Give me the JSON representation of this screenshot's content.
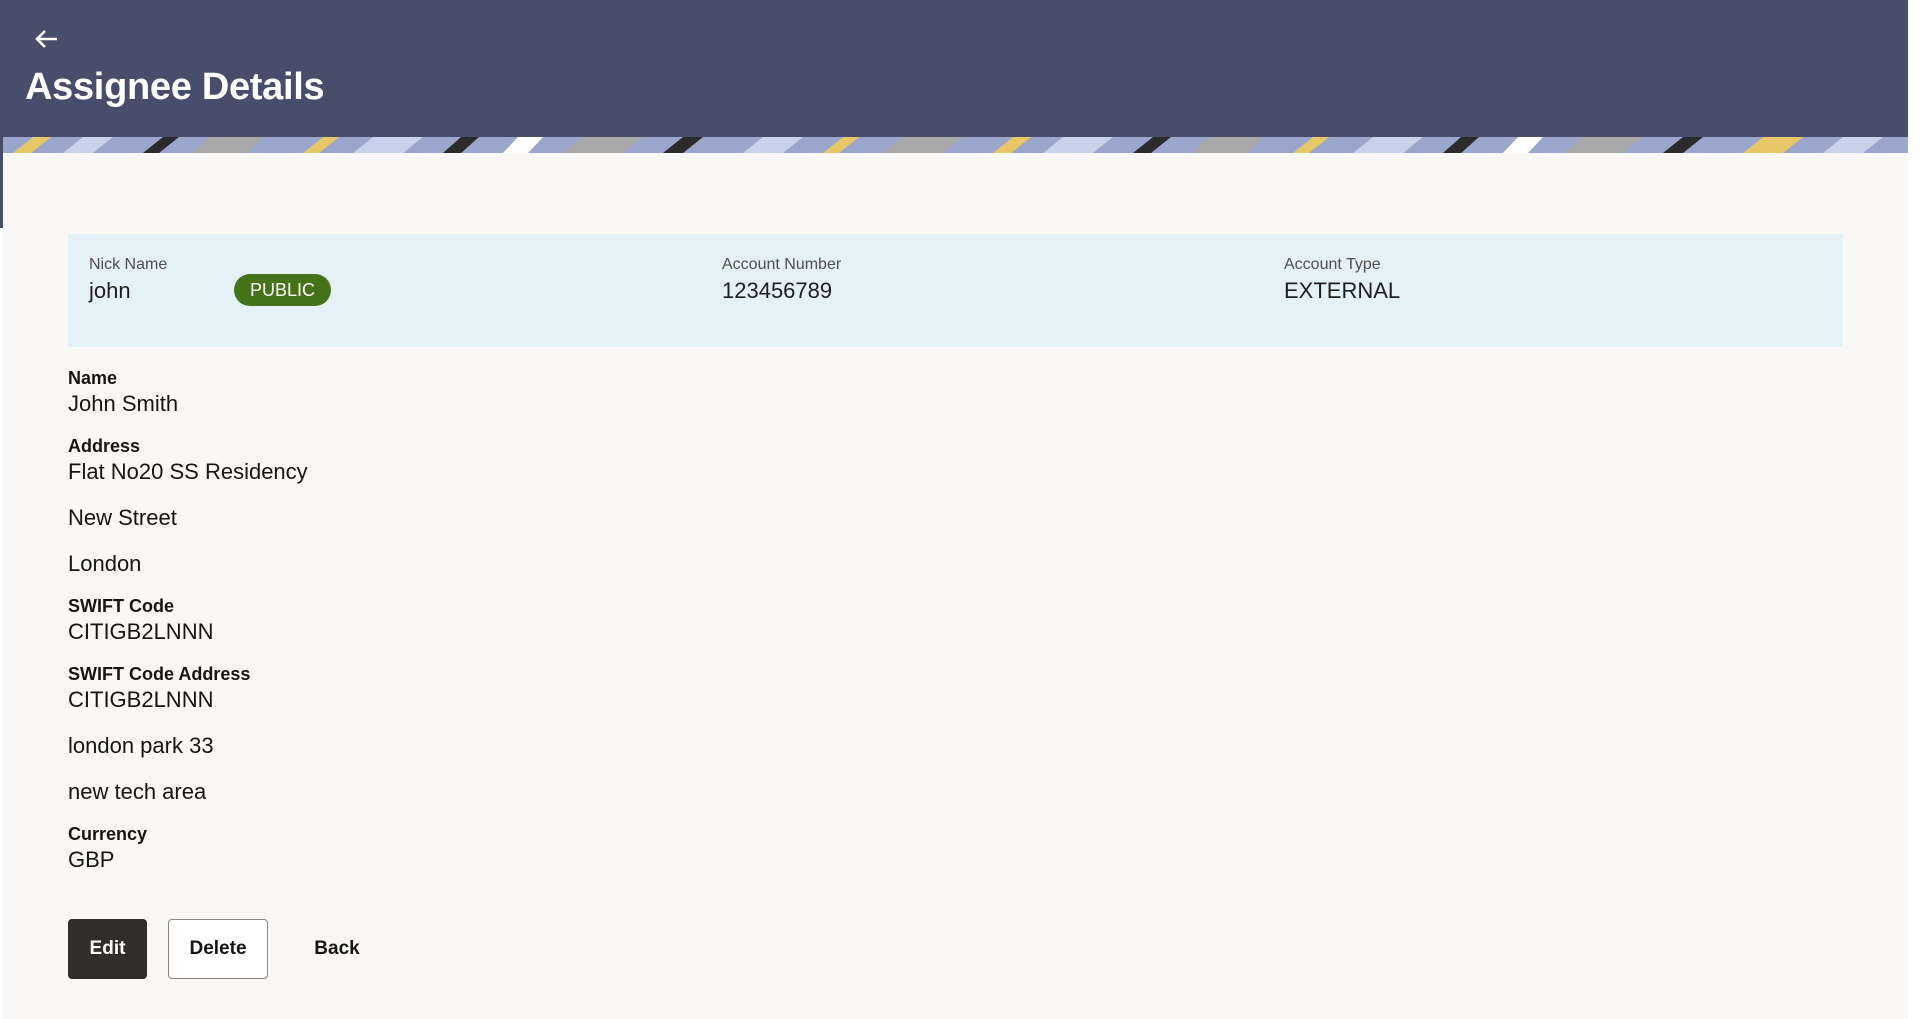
{
  "header": {
    "title": "Assignee Details",
    "back_icon": "arrow-left-icon",
    "background_color": "#474d6b"
  },
  "summary": {
    "nick_name_label": "Nick Name",
    "nick_name_value": "john",
    "visibility_badge": "PUBLIC",
    "badge_color": "#467219",
    "account_number_label": "Account Number",
    "account_number_value": "123456789",
    "account_type_label": "Account Type",
    "account_type_value": "EXTERNAL"
  },
  "details": {
    "name_label": "Name",
    "name_value": "John Smith",
    "address_label": "Address",
    "address_lines": [
      "Flat No20 SS Residency",
      "New Street",
      "London"
    ],
    "swift_code_label": "SWIFT Code",
    "swift_code_value": "CITIGB2LNNN",
    "swift_address_label": "SWIFT Code Address",
    "swift_address_lines": [
      "CITIGB2LNNN",
      "london park 33",
      "new tech area"
    ],
    "currency_label": "Currency",
    "currency_value": "GBP"
  },
  "actions": {
    "edit_label": "Edit",
    "delete_label": "Delete",
    "back_label": "Back"
  }
}
